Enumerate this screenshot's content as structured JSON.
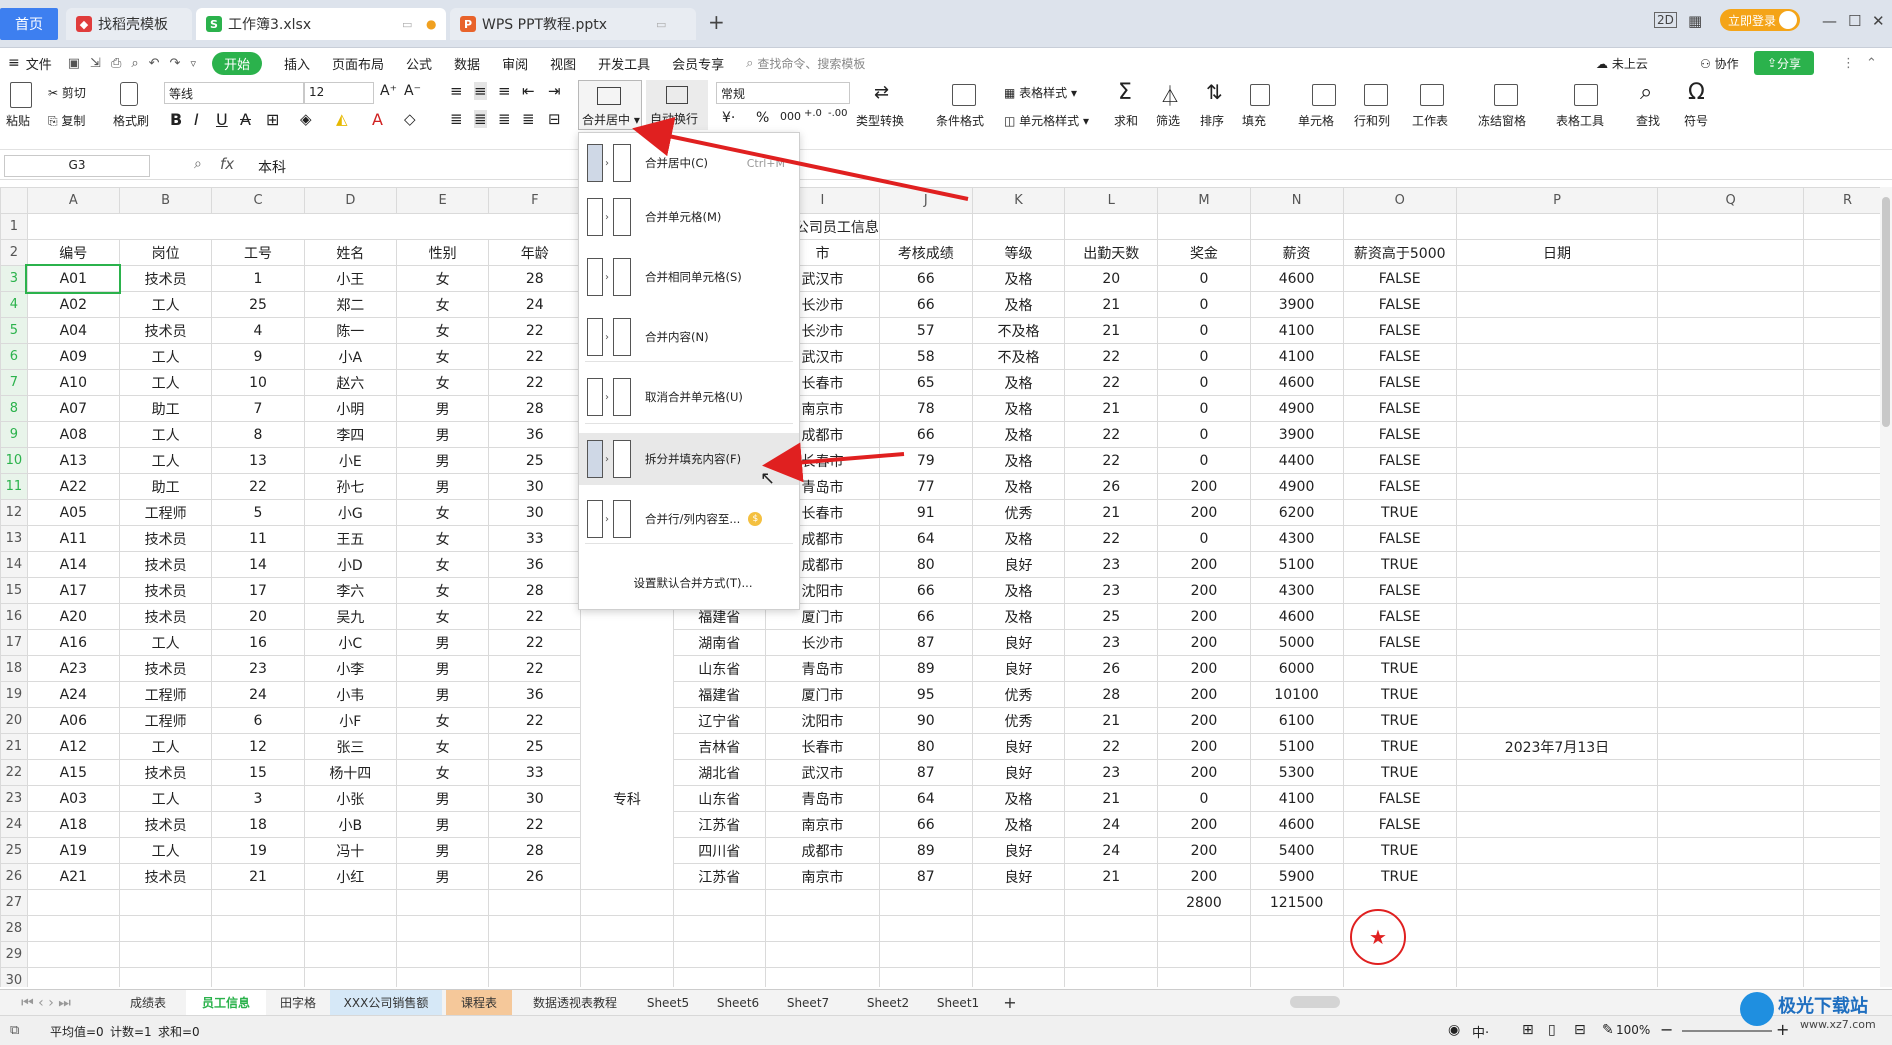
{
  "tabs": {
    "home": "首页",
    "t1": "找稻壳模板",
    "t2": "工作簿3.xlsx",
    "t3": "WPS PPT教程.pptx",
    "login": "立即登录"
  },
  "menu": {
    "file": "文件",
    "items": [
      "开始",
      "插入",
      "页面布局",
      "公式",
      "数据",
      "审阅",
      "视图",
      "开发工具",
      "会员专享"
    ],
    "search": "查找命令、搜索模板",
    "cloud": "未上云",
    "collab": "协作",
    "share": "分享"
  },
  "ribbon": {
    "paste": "粘贴",
    "cut": "剪切",
    "copy": "复制",
    "format_painter": "格式刷",
    "font_name": "等线",
    "font_size": "12",
    "merge_center": "合并居中",
    "wrap": "自动换行",
    "number_format": "常规",
    "type_convert": "类型转换",
    "cond_format": "条件格式",
    "table_style": "表格样式",
    "cell_style": "单元格样式",
    "sum": "求和",
    "filter": "筛选",
    "sort": "排序",
    "fill": "填充",
    "cell": "单元格",
    "rowcol": "行和列",
    "worksheet": "工作表",
    "freeze": "冻结窗格",
    "table_tools": "表格工具",
    "find": "查找",
    "symbol": "符号"
  },
  "formula": {
    "cell_ref": "G3",
    "fx": "fx",
    "content": "本科"
  },
  "dropdown": {
    "items": [
      {
        "label": "合并居中(C)",
        "shortcut": "Ctrl+M"
      },
      {
        "label": "合并单元格(M)"
      },
      {
        "label": "合并相同单元格(S)"
      },
      {
        "label": "合并内容(N)"
      },
      {
        "label": "取消合并单元格(U)"
      },
      {
        "label": "拆分并填充内容(F)"
      },
      {
        "label": "合并行/列内容至..."
      },
      {
        "label": "设置默认合并方式(T)..."
      }
    ]
  },
  "sheet": {
    "columns": [
      "A",
      "B",
      "C",
      "D",
      "E",
      "F",
      "G",
      "H",
      "I",
      "J",
      "K",
      "L",
      "M",
      "N",
      "O",
      "P",
      "Q",
      "R"
    ],
    "title": "XXX公司员工信息",
    "headers": [
      "编号",
      "岗位",
      "工号",
      "姓名",
      "性别",
      "年龄",
      "",
      "",
      "市",
      "考核成绩",
      "等级",
      "出勤天数",
      "奖金",
      "薪资",
      "薪资高于5000",
      "日期"
    ],
    "rows": [
      [
        "A01",
        "技术员",
        "1",
        "小王",
        "女",
        "28",
        "",
        "",
        "武汉市",
        "66",
        "及格",
        "20",
        "0",
        "4600",
        "FALSE",
        ""
      ],
      [
        "A02",
        "工人",
        "25",
        "郑二",
        "女",
        "24",
        "",
        "",
        "长沙市",
        "66",
        "及格",
        "21",
        "0",
        "3900",
        "FALSE",
        ""
      ],
      [
        "A04",
        "技术员",
        "4",
        "陈一",
        "女",
        "22",
        "",
        "",
        "长沙市",
        "57",
        "不及格",
        "21",
        "0",
        "4100",
        "FALSE",
        ""
      ],
      [
        "A09",
        "工人",
        "9",
        "小A",
        "女",
        "22",
        "",
        "",
        "武汉市",
        "58",
        "不及格",
        "22",
        "0",
        "4100",
        "FALSE",
        ""
      ],
      [
        "A10",
        "工人",
        "10",
        "赵六",
        "女",
        "22",
        "",
        "",
        "长春市",
        "65",
        "及格",
        "22",
        "0",
        "4600",
        "FALSE",
        ""
      ],
      [
        "A07",
        "助工",
        "7",
        "小明",
        "男",
        "28",
        "",
        "",
        "南京市",
        "78",
        "及格",
        "21",
        "0",
        "4900",
        "FALSE",
        ""
      ],
      [
        "A08",
        "工人",
        "8",
        "李四",
        "男",
        "36",
        "",
        "",
        "成都市",
        "66",
        "及格",
        "22",
        "0",
        "3900",
        "FALSE",
        ""
      ],
      [
        "A13",
        "工人",
        "13",
        "小E",
        "男",
        "25",
        "",
        "",
        "长春市",
        "79",
        "及格",
        "22",
        "0",
        "4400",
        "FALSE",
        ""
      ],
      [
        "A22",
        "助工",
        "22",
        "孙七",
        "男",
        "30",
        "",
        "",
        "青岛市",
        "77",
        "及格",
        "26",
        "200",
        "4900",
        "FALSE",
        ""
      ],
      [
        "A05",
        "工程师",
        "5",
        "小G",
        "女",
        "30",
        "",
        "",
        "长春市",
        "91",
        "优秀",
        "21",
        "200",
        "6200",
        "TRUE",
        ""
      ],
      [
        "A11",
        "技术员",
        "11",
        "王五",
        "女",
        "33",
        "",
        "",
        "成都市",
        "64",
        "及格",
        "22",
        "0",
        "4300",
        "FALSE",
        ""
      ],
      [
        "A14",
        "技术员",
        "14",
        "小D",
        "女",
        "36",
        "",
        "",
        "成都市",
        "80",
        "良好",
        "23",
        "200",
        "5100",
        "TRUE",
        ""
      ],
      [
        "A17",
        "技术员",
        "17",
        "李六",
        "女",
        "28",
        "",
        "",
        "沈阳市",
        "66",
        "及格",
        "23",
        "200",
        "4300",
        "FALSE",
        ""
      ],
      [
        "A20",
        "技术员",
        "20",
        "吴九",
        "女",
        "22",
        "",
        "福建省",
        "厦门市",
        "66",
        "及格",
        "25",
        "200",
        "4600",
        "FALSE",
        ""
      ],
      [
        "A16",
        "工人",
        "16",
        "小C",
        "男",
        "22",
        "",
        "湖南省",
        "长沙市",
        "87",
        "良好",
        "23",
        "200",
        "5000",
        "FALSE",
        ""
      ],
      [
        "A23",
        "技术员",
        "23",
        "小李",
        "男",
        "22",
        "",
        "山东省",
        "青岛市",
        "89",
        "良好",
        "26",
        "200",
        "6000",
        "TRUE",
        ""
      ],
      [
        "A24",
        "工程师",
        "24",
        "小韦",
        "男",
        "36",
        "",
        "福建省",
        "厦门市",
        "95",
        "优秀",
        "28",
        "200",
        "10100",
        "TRUE",
        ""
      ],
      [
        "A06",
        "工程师",
        "6",
        "小F",
        "女",
        "22",
        "",
        "辽宁省",
        "沈阳市",
        "90",
        "优秀",
        "21",
        "200",
        "6100",
        "TRUE",
        ""
      ],
      [
        "A12",
        "工人",
        "12",
        "张三",
        "女",
        "25",
        "",
        "吉林省",
        "长春市",
        "80",
        "良好",
        "22",
        "200",
        "5100",
        "TRUE",
        "2023年7月13日"
      ],
      [
        "A15",
        "技术员",
        "15",
        "杨十四",
        "女",
        "33",
        "",
        "湖北省",
        "武汉市",
        "87",
        "良好",
        "23",
        "200",
        "5300",
        "TRUE",
        ""
      ],
      [
        "A03",
        "工人",
        "3",
        "小张",
        "男",
        "30",
        "专科",
        "山东省",
        "青岛市",
        "64",
        "及格",
        "21",
        "0",
        "4100",
        "FALSE",
        ""
      ],
      [
        "A18",
        "技术员",
        "18",
        "小B",
        "男",
        "22",
        "",
        "江苏省",
        "南京市",
        "66",
        "及格",
        "24",
        "200",
        "4600",
        "FALSE",
        ""
      ],
      [
        "A19",
        "工人",
        "19",
        "冯十",
        "男",
        "28",
        "",
        "四川省",
        "成都市",
        "89",
        "良好",
        "24",
        "200",
        "5400",
        "TRUE",
        ""
      ],
      [
        "A21",
        "技术员",
        "21",
        "小红",
        "男",
        "26",
        "",
        "江苏省",
        "南京市",
        "87",
        "良好",
        "21",
        "200",
        "5900",
        "TRUE",
        ""
      ]
    ],
    "totals": {
      "bonus": "2800",
      "salary": "121500"
    }
  },
  "sheet_tabs": [
    "成绩表",
    "员工信息",
    "田字格",
    "XXX公司销售额",
    "课程表",
    "数据透视表教程",
    "Sheet5",
    "Sheet6",
    "Sheet7",
    "Sheet2",
    "Sheet1"
  ],
  "status": {
    "avg": "平均值=0",
    "count": "计数=1",
    "sum": "求和=0",
    "zoom": "100%",
    "ime": "中"
  },
  "watermark": "极光下载站",
  "watermark_url": "www.xz7.com",
  "colors": {
    "accent": "#2bb24c",
    "tab_blue": "#3d7ff0",
    "arrow": "#e02020"
  }
}
